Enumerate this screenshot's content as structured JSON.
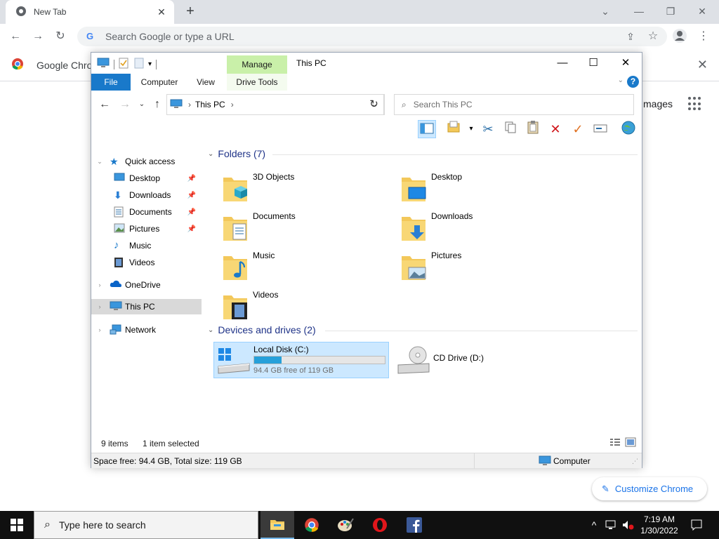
{
  "chrome": {
    "tab_title": "New Tab",
    "omnibox_placeholder": "Search Google or type a URL",
    "bookmark_label": "Google Chrome",
    "images_link": "mages",
    "customize_label": "Customize Chrome"
  },
  "explorer": {
    "window_title": "This PC",
    "manage_tab": "Manage",
    "ribbon_tabs": [
      "File",
      "Computer",
      "View",
      "Drive Tools"
    ],
    "breadcrumb": "This PC",
    "search_placeholder": "Search This PC",
    "nav": {
      "quick_access": "Quick access",
      "items": [
        "Desktop",
        "Downloads",
        "Documents",
        "Pictures",
        "Music",
        "Videos"
      ],
      "onedrive": "OneDrive",
      "this_pc": "This PC",
      "network": "Network"
    },
    "folders_header": "Folders (7)",
    "folders": [
      "3D Objects",
      "Desktop",
      "Documents",
      "Downloads",
      "Music",
      "Pictures",
      "Videos"
    ],
    "devices_header": "Devices and drives (2)",
    "drives": [
      {
        "name": "Local Disk (C:)",
        "free": "94.4 GB free of 119 GB",
        "used_fraction": 0.21
      },
      {
        "name": "CD Drive (D:)"
      }
    ],
    "status_items": "9 items",
    "status_selected": "1 item selected",
    "details_space": "Space free: 94.4 GB, Total size: 119 GB",
    "details_location": "Computer"
  },
  "taskbar": {
    "search_placeholder": "Type here to search",
    "time": "7:19 AM",
    "date": "1/30/2022"
  },
  "colors": {
    "accent": "#1979ca",
    "manage_green": "#c9f0a9",
    "selection": "#cce8ff",
    "drive_bar": "#26a0da"
  }
}
